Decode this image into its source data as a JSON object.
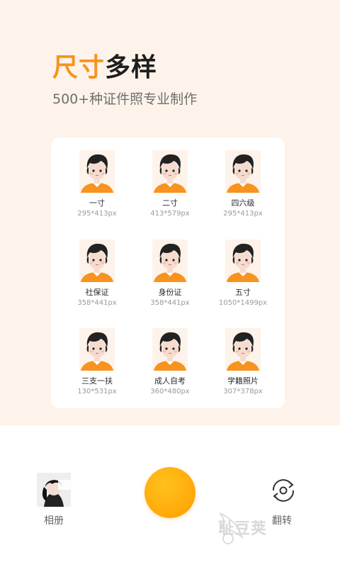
{
  "hero": {
    "title_accent": "尺寸",
    "title_rest": "多样",
    "subtitle": "500+种证件照专业制作"
  },
  "sizes": [
    {
      "name": "一寸",
      "size": "295*413px"
    },
    {
      "name": "二寸",
      "size": "413*579px"
    },
    {
      "name": "四六级",
      "size": "295*413px"
    },
    {
      "name": "社保证",
      "size": "358*441px"
    },
    {
      "name": "身份证",
      "size": "358*441px"
    },
    {
      "name": "五寸",
      "size": "1050*1499px"
    },
    {
      "name": "三支一扶",
      "size": "130*531px"
    },
    {
      "name": "成人自考",
      "size": "360*480px"
    },
    {
      "name": "学籍照片",
      "size": "307*378px"
    }
  ],
  "bottom": {
    "album_label": "相册",
    "flip_label": "翻转",
    "watermark": "耻豆荚"
  },
  "colors": {
    "accent": "#f7931e",
    "hero_bg": "#fdf3ea",
    "shutter": "#ffae0d"
  },
  "icons": {
    "photo": "avatar-photo",
    "flip": "rotate-camera-icon",
    "album": "album-thumbnail"
  }
}
